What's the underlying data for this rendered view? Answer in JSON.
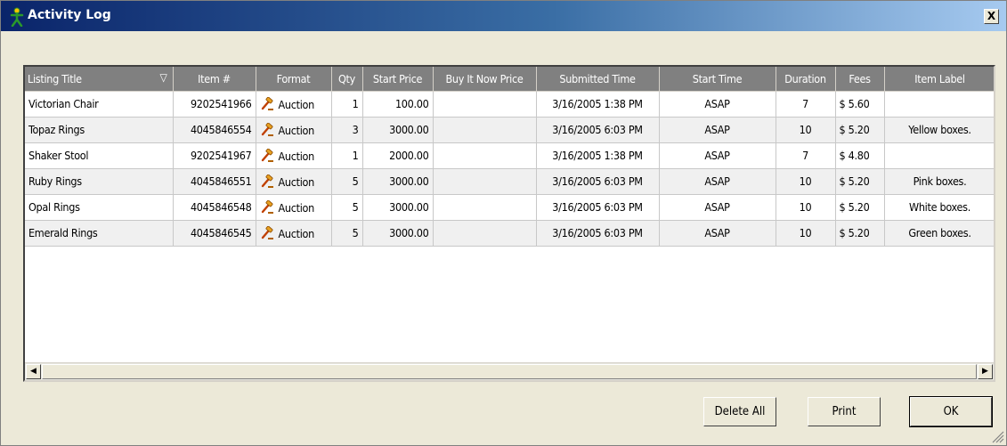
{
  "window": {
    "title": "Activity Log",
    "close_label": "X"
  },
  "grid": {
    "columns": [
      "Listing Title",
      "Item #",
      "Format",
      "Qty",
      "Start Price",
      "Buy It Now Price",
      "Submitted Time",
      "Start Time",
      "Duration",
      "Fees",
      "Item Label"
    ],
    "sort_indicator": "▽",
    "rows": [
      {
        "title": "Victorian Chair",
        "item": "9202541966",
        "format": "Auction",
        "qty": "1",
        "start_price": "100.00",
        "bin_price": "",
        "submitted": "3/16/2005 1:38 PM",
        "start_time": "ASAP",
        "duration": "7",
        "fees": "$ 5.60",
        "label": ""
      },
      {
        "title": "Topaz Rings",
        "item": "4045846554",
        "format": "Auction",
        "qty": "3",
        "start_price": "3000.00",
        "bin_price": "",
        "submitted": "3/16/2005 6:03 PM",
        "start_time": "ASAP",
        "duration": "10",
        "fees": "$ 5.20",
        "label": "Yellow boxes."
      },
      {
        "title": "Shaker Stool",
        "item": "9202541967",
        "format": "Auction",
        "qty": "1",
        "start_price": "2000.00",
        "bin_price": "",
        "submitted": "3/16/2005 1:38 PM",
        "start_time": "ASAP",
        "duration": "7",
        "fees": "$ 4.80",
        "label": ""
      },
      {
        "title": "Ruby Rings",
        "item": "4045846551",
        "format": "Auction",
        "qty": "5",
        "start_price": "3000.00",
        "bin_price": "",
        "submitted": "3/16/2005 6:03 PM",
        "start_time": "ASAP",
        "duration": "10",
        "fees": "$ 5.20",
        "label": "Pink boxes."
      },
      {
        "title": "Opal Rings",
        "item": "4045846548",
        "format": "Auction",
        "qty": "5",
        "start_price": "3000.00",
        "bin_price": "",
        "submitted": "3/16/2005 6:03 PM",
        "start_time": "ASAP",
        "duration": "10",
        "fees": "$ 5.20",
        "label": "White boxes."
      },
      {
        "title": "Emerald Rings",
        "item": "4045846545",
        "format": "Auction",
        "qty": "5",
        "start_price": "3000.00",
        "bin_price": "",
        "submitted": "3/16/2005 6:03 PM",
        "start_time": "ASAP",
        "duration": "10",
        "fees": "$ 5.20",
        "label": "Green boxes."
      }
    ]
  },
  "scrollbar": {
    "left_arrow": "◀",
    "right_arrow": "▶"
  },
  "buttons": {
    "delete_all": "Delete All",
    "print": "Print",
    "ok": "OK"
  },
  "icons": {
    "app": "activity-log-figure-icon",
    "format": "auction-gavel-icon"
  },
  "colors": {
    "titlebar_start": "#0a246a",
    "titlebar_end": "#a6caf0",
    "header_bg": "#808080",
    "window_bg": "#ece9d8"
  }
}
